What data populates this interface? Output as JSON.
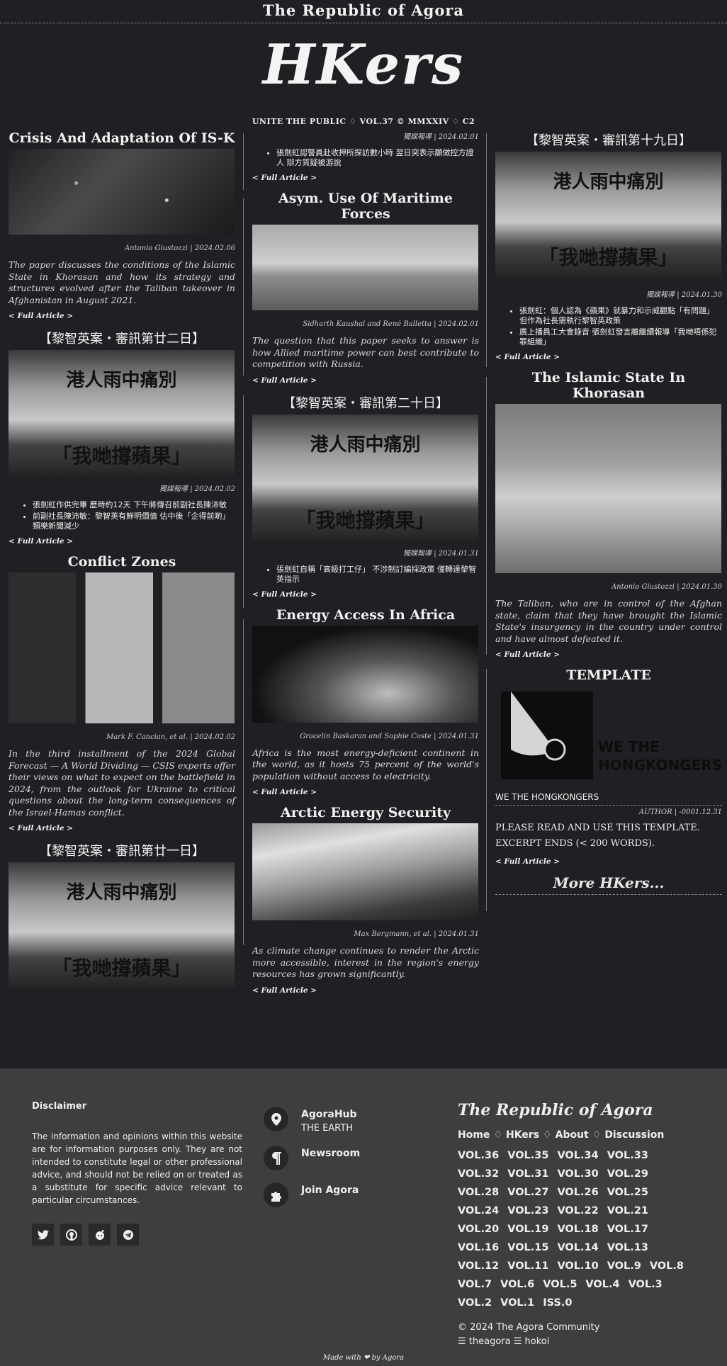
{
  "site": {
    "topbar_title": "The Republic of Agora",
    "logo": "HKers",
    "tagline": "UNITE THE PUBLIC ♢ VOL.37 © MMXXIV ♢ C2"
  },
  "col1": {
    "a1": {
      "title": "Crisis And Adaptation Of IS-K",
      "meta": "Antonio Giustozzi | 2024.02.06",
      "summary": "The paper discusses the conditions of the Islamic State in Khorasan and how its strategy and structures evolved after the Taliban takeover in Afghanistan in August 2021.",
      "more": "< Full Article >"
    },
    "a2": {
      "title": "【黎智英案・審訊第廿二日】",
      "meta": "獨媒報導 | 2024.02.02",
      "bullets": [
        "張劍虹作供完畢 歷時約12天 下午將傳召前副社長陳沛敏",
        "前副社長陳沛敏：黎智英有鮮明價值 估中後「企得前啲」 類樂新聞減少"
      ],
      "more": "< Full Article >",
      "img_top": "港人雨中痛別",
      "img_bottom": "「我哋撐蘋果」"
    },
    "a3": {
      "title": "Conflict Zones",
      "meta": "Mark F. Cancian, et al. | 2024.02.02",
      "summary": "In the third installment of the 2024 Global Forecast — A World Dividing — CSIS experts offer their views on what to expect on the battlefield in 2024, from the outlook for Ukraine to critical questions about the long-term consequences of the Israel-Hamas conflict.",
      "more": "< Full Article >"
    },
    "a4": {
      "title": "【黎智英案・審訊第廿一日】",
      "img_top": "港人雨中痛別",
      "img_bottom": "「我哋撐蘋果」"
    }
  },
  "col2": {
    "a0": {
      "meta": "獨媒報導 | 2024.02.01",
      "bullets": [
        "張劍虹認警員赴收押所探訪數小時 翌日突表示願做控方證人 辯方質疑被游說"
      ],
      "more": "< Full Article >"
    },
    "a1": {
      "title": "Asym. Use Of Maritime Forces",
      "meta": "Sidharth Kaushal and René Balletta | 2024.02.01",
      "summary": "The question that this paper seeks to answer is how Allied maritime power can best contribute to competition with Russia.",
      "more": "< Full Article >"
    },
    "a2": {
      "title": "【黎智英案・審訊第二十日】",
      "meta": "獨媒報導 | 2024.01.31",
      "bullets": [
        "張劍虹自稱「高級打工仔」 不涉制訂編採政策 僅轉達黎智英指示"
      ],
      "more": "< Full Article >",
      "img_top": "港人雨中痛別",
      "img_bottom": "「我哋撐蘋果」"
    },
    "a3": {
      "title": "Energy Access In Africa",
      "meta": "Gracelin Baskaran and Sophie Coste | 2024.01.31",
      "summary": "Africa is the most energy-deficient continent in the world, as it hosts 75 percent of the world's population without access to electricity.",
      "more": "< Full Article >"
    },
    "a4": {
      "title": "Arctic Energy Security",
      "meta": "Max Bergmann, et al. | 2024.01.31",
      "summary": "As climate change continues to render the Arctic more accessible, interest in the region's energy resources has grown significantly.",
      "more": "< Full Article >"
    }
  },
  "col3": {
    "a1": {
      "title": "【黎智英案・審訊第十九日】",
      "meta": "獨媒報導 | 2024.01.30",
      "bullets": [
        "張劍虹：個人認為《蘋果》就暴力和示威觀點「有問題」 但作為社長需執行黎智英政策",
        "廣上播員工大會錄音 張劍虹發言離繼續報導「我哋唔係犯罪組織」"
      ],
      "more": "< Full Article >",
      "img_top": "港人雨中痛別",
      "img_bottom": "「我哋撐蘋果」"
    },
    "a2": {
      "title": "The Islamic State In Khorasan",
      "meta": "Antonio Giustozzi | 2024.01.30",
      "summary": "The Taliban, who are in control of the Afghan state, claim that they have brought the Islamic State's insurgency in the country under control and have almost defeated it.",
      "more": "< Full Article >"
    },
    "a3": {
      "title": "TEMPLATE",
      "img_text_line1": "WE THE",
      "img_text_line2": "HONGKONGERS",
      "caption": "WE THE HONGKONGERS",
      "meta": "AUTHOR | -0001.12.31",
      "body_line1": "PLEASE READ AND USE THIS TEMPLATE.",
      "body_line2": "EXCERPT ENDS (< 200 WORDS).",
      "more": "< Full Article >"
    },
    "more_hkers": "More HKers..."
  },
  "footer": {
    "disclaimer_title": "Disclaimer",
    "disclaimer_text": "The information and opinions within this website are for information purposes only. They are not intended to constitute legal or other professional advice, and should not be relied on or treated as a substitute for specific advice relevant to particular circumstances.",
    "links": [
      {
        "label": "AgoraHub",
        "sub": "THE EARTH",
        "icon": "map-pin-icon"
      },
      {
        "label": "Newsroom",
        "sub": "",
        "icon": "paragraph-icon"
      },
      {
        "label": "Join Agora",
        "sub": "",
        "icon": "puzzle-icon"
      }
    ],
    "brand": "The Republic of Agora",
    "nav": [
      "Home",
      "HKers",
      "About",
      "Discussion"
    ],
    "nav_sep": "♢",
    "volumes": [
      "VOL.36",
      "VOL.35",
      "VOL.34",
      "VOL.33",
      "VOL.32",
      "VOL.31",
      "VOL.30",
      "VOL.29",
      "VOL.28",
      "VOL.27",
      "VOL.26",
      "VOL.25",
      "VOL.24",
      "VOL.23",
      "VOL.22",
      "VOL.21",
      "VOL.20",
      "VOL.19",
      "VOL.18",
      "VOL.17",
      "VOL.16",
      "VOL.15",
      "VOL.14",
      "VOL.13",
      "VOL.12",
      "VOL.11",
      "VOL.10",
      "VOL.9",
      "VOL.8",
      "VOL.7",
      "VOL.6",
      "VOL.5",
      "VOL.4",
      "VOL.3",
      "VOL.2",
      "VOL.1",
      "ISS.0"
    ],
    "copyright": "© 2024 The Agora Community",
    "handles": "☰ theagora ☰ hokoi",
    "made_with": "Made with ❤ by Agora"
  }
}
